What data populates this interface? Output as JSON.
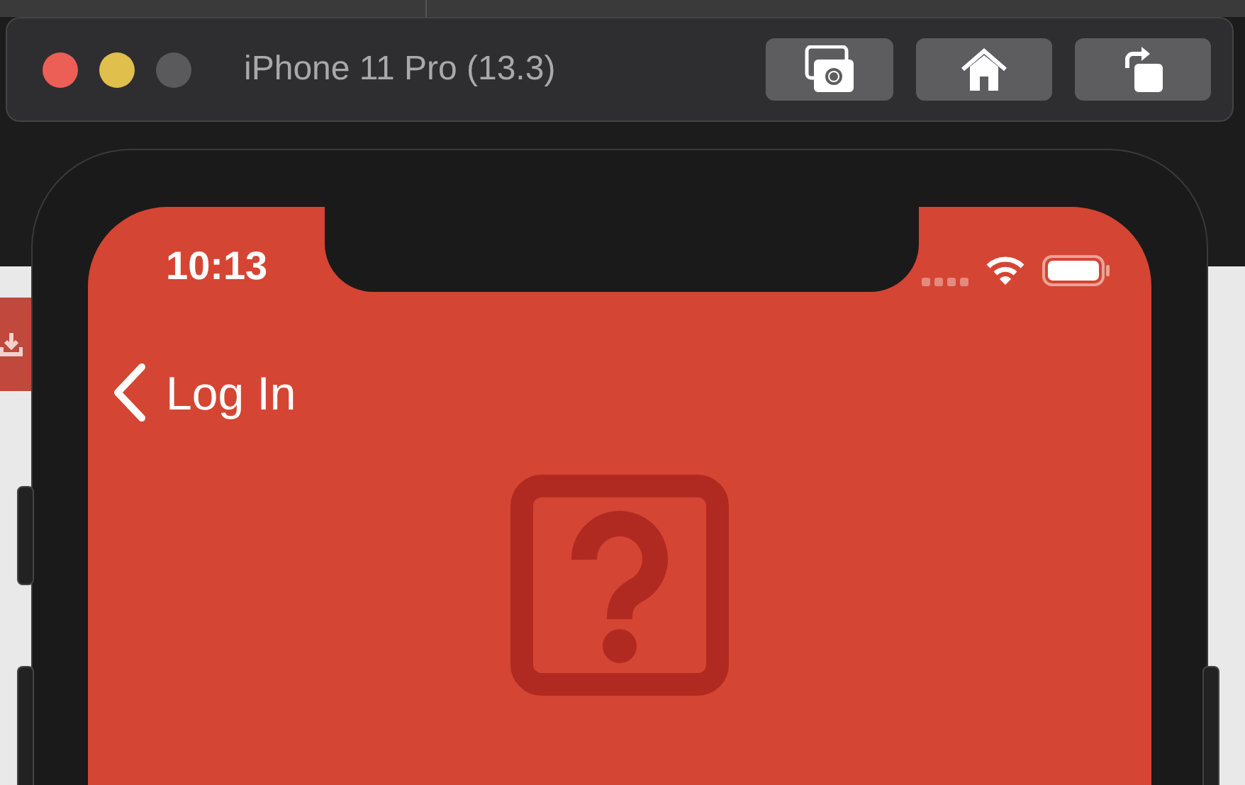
{
  "window": {
    "title": "iPhone 11 Pro (13.3)"
  },
  "status_bar": {
    "time": "10:13"
  },
  "navigation": {
    "back_label": "Log In"
  }
}
